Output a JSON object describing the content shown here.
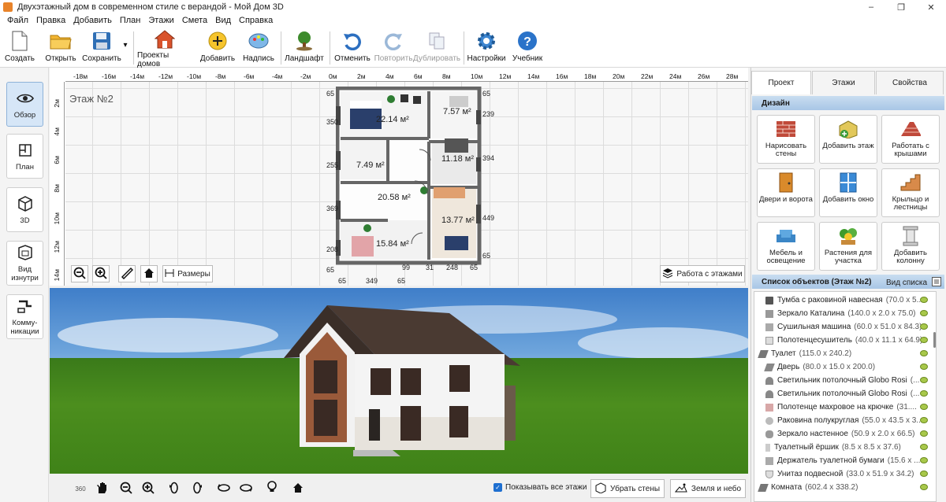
{
  "window": {
    "title": "Двухэтажный дом в современном стиле с верандой - Мой Дом 3D",
    "controls": [
      "–",
      "❐",
      "✕"
    ]
  },
  "menu": [
    "Файл",
    "Правка",
    "Добавить",
    "План",
    "Этажи",
    "Смета",
    "Вид",
    "Справка"
  ],
  "toolbar": {
    "create": "Создать",
    "open": "Открыть",
    "save": "Сохранить",
    "save_dropdown": "▾",
    "projects": "Проекты домов",
    "add": "Добавить",
    "label": "Надпись",
    "landscape": "Ландшафт",
    "undo": "Отменить",
    "redo": "Повторить",
    "duplicate": "Дублировать",
    "settings": "Настройки",
    "tutorial": "Учебник"
  },
  "leftbar": {
    "overview": "Обзор",
    "plan": "План",
    "view3d": "3D",
    "inside": "Вид изнутри",
    "utilities": "Комму-никации"
  },
  "plan": {
    "floor_label": "Этаж №2",
    "ruler_h": [
      "-18м",
      "-16м",
      "-14м",
      "-12м",
      "-10м",
      "-8м",
      "-6м",
      "-4м",
      "-2м",
      "0м",
      "2м",
      "4м",
      "6м",
      "8м",
      "10м",
      "12м",
      "14м",
      "16м",
      "18м",
      "20м",
      "22м",
      "24м",
      "26м",
      "28м"
    ],
    "ruler_v": [
      "2м",
      "4м",
      "6м",
      "8м",
      "10м",
      "12м",
      "14м"
    ],
    "rooms": [
      "22.14 м²",
      "7.57 м²",
      "7.49 м²",
      "11.18 м²",
      "20.58 м²",
      "13.77 м²",
      "15.84 м²"
    ],
    "dims_left": [
      "65",
      "350",
      "255",
      "369",
      "208",
      "65"
    ],
    "dims_right": [
      "65",
      "239",
      "394",
      "449",
      "65"
    ],
    "dims_bottom": [
      "65",
      "349",
      "65",
      "99",
      "31",
      "248",
      "65"
    ],
    "sizes_button": "Размеры",
    "floors_button": "Работа с этажами"
  },
  "bottombar": {
    "show_all_floors": "Показывать все этажи",
    "remove_walls": "Убрать стены",
    "earth_sky": "Земля и небо",
    "rotate360": "360"
  },
  "rightpanel": {
    "tabs": [
      "Проект",
      "Этажи",
      "Свойства"
    ],
    "design_header": "Дизайн",
    "design_buttons": [
      "Нарисовать стены",
      "Добавить этаж",
      "Работать с крышами",
      "Двери и ворота",
      "Добавить окно",
      "Крыльцо и лестницы",
      "Мебель и освещение",
      "Растения для участка",
      "Добавить колонну"
    ],
    "objects_header": "Список объектов (Этаж №2)",
    "view_list": "Вид списка",
    "objects": [
      {
        "name": "Тумба с раковиной навесная",
        "dims": "(70.0 x 5..."
      },
      {
        "name": "Зеркало Каталина",
        "dims": "(140.0 x 2.0 x 75.0)"
      },
      {
        "name": "Сушильная машина",
        "dims": "(60.0 x 51.0 x 84.3)"
      },
      {
        "name": "Полотенцесушитель",
        "dims": "(40.0 x 11.1 x 64.9)"
      },
      {
        "name": "Туалет",
        "dims": "(115.0 x 240.2)",
        "group": true
      },
      {
        "name": "Дверь",
        "dims": "(80.0 x 15.0 x 200.0)"
      },
      {
        "name": "Светильник потолочный Globo Rosi",
        "dims": "(..."
      },
      {
        "name": "Светильник потолочный Globo Rosi",
        "dims": "(..."
      },
      {
        "name": "Полотенце махровое на крючке",
        "dims": "(31...."
      },
      {
        "name": "Раковина полукруглая",
        "dims": "(55.0 x 43.5 x 3..."
      },
      {
        "name": "Зеркало настенное",
        "dims": "(50.9 x 2.0 x 66.5)"
      },
      {
        "name": "Туалетный ёршик",
        "dims": "(8.5 x 8.5 x 37.6)"
      },
      {
        "name": "Держатель туалетной бумаги",
        "dims": "(15.6 x ..."
      },
      {
        "name": "Унитаз подвесной",
        "dims": "(33.0 x 51.9 x 34.2)"
      },
      {
        "name": "Комната",
        "dims": "(602.4 x 338.2)",
        "group": true
      }
    ]
  }
}
